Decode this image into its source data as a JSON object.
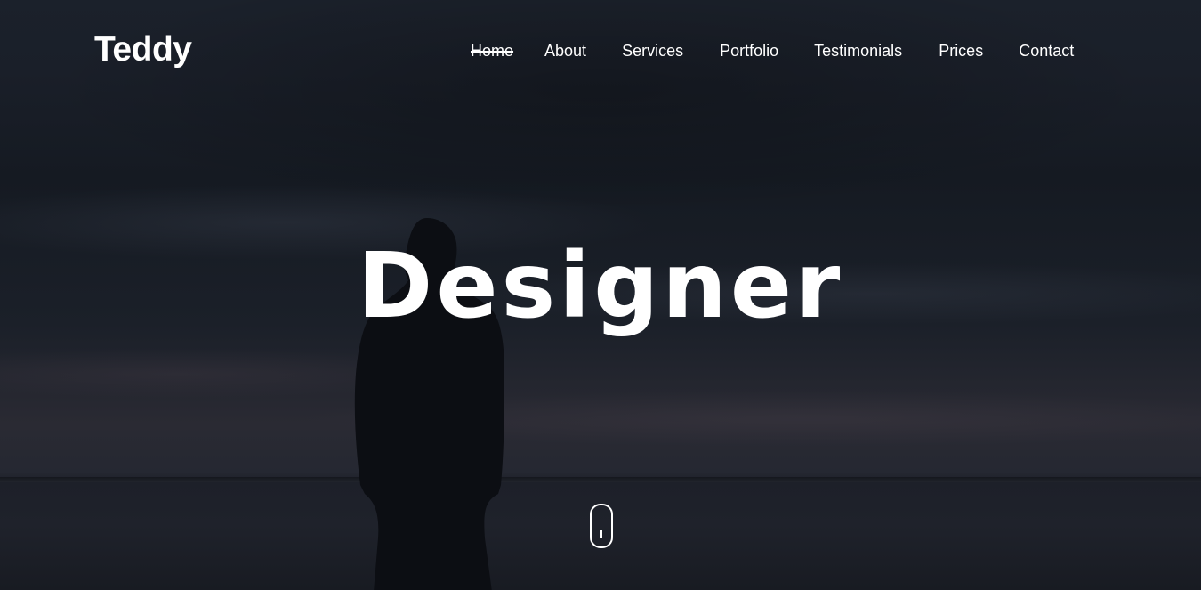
{
  "brand": {
    "logo_text": "Teddy"
  },
  "nav": {
    "items": [
      {
        "label": "Home",
        "active": true
      },
      {
        "label": "About",
        "active": false
      },
      {
        "label": "Services",
        "active": false
      },
      {
        "label": "Portfolio",
        "active": false
      },
      {
        "label": "Testimonials",
        "active": false
      },
      {
        "label": "Prices",
        "active": false
      },
      {
        "label": "Contact",
        "active": false
      }
    ]
  },
  "hero": {
    "headline": "Designer",
    "scroll_indicator_icon": "mouse-scroll-icon"
  },
  "colors": {
    "text": "#ffffff",
    "background": "#151a22"
  }
}
